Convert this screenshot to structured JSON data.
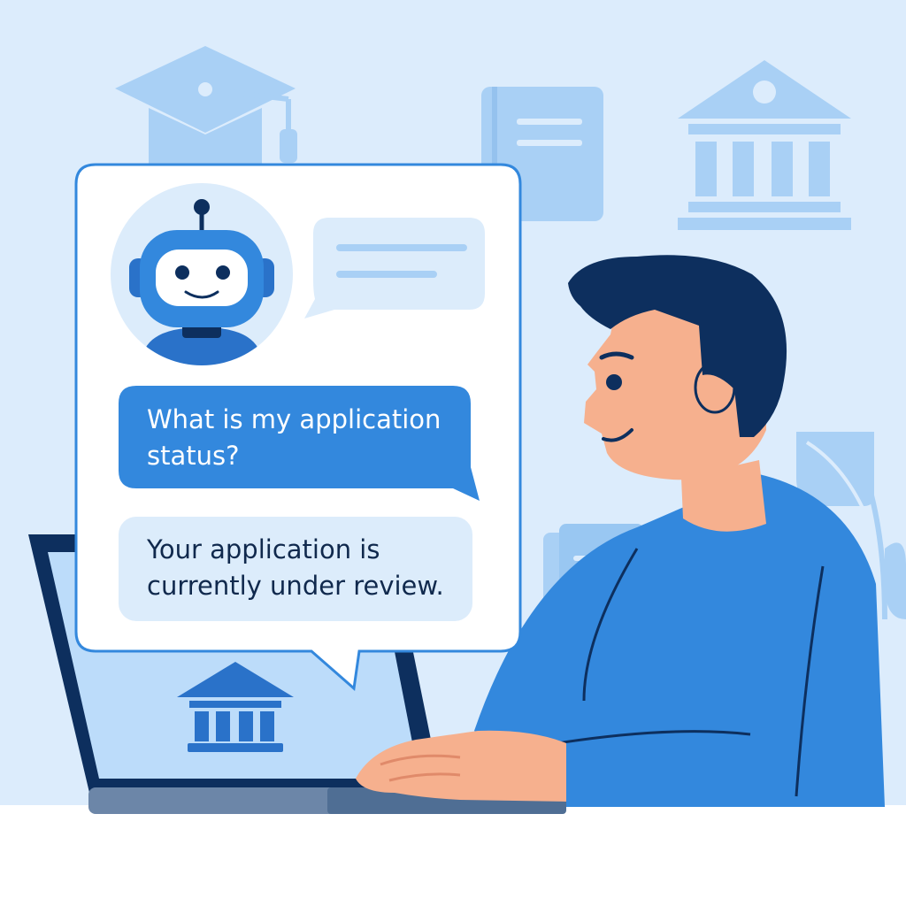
{
  "chat": {
    "user_message": "What is my application status?",
    "bot_reply": "Your application is currently under review."
  },
  "icons": {
    "background": [
      "graduation-cap-icon",
      "book-icon",
      "university-icon",
      "leaf-icon",
      "books-icon"
    ],
    "chat": [
      "robot-avatar-icon",
      "typing-bubble-icon"
    ],
    "laptop_screen": [
      "university-icon"
    ]
  },
  "colors": {
    "background": "#dcecfc",
    "background_icons": "#a9d0f5",
    "accent": "#3388dd",
    "user_bubble": "#3388dd",
    "bot_bubble": "#dcecfb",
    "dark_navy": "#0d2f5e",
    "skin": "#f6b08e",
    "floor": "#ffffff"
  }
}
